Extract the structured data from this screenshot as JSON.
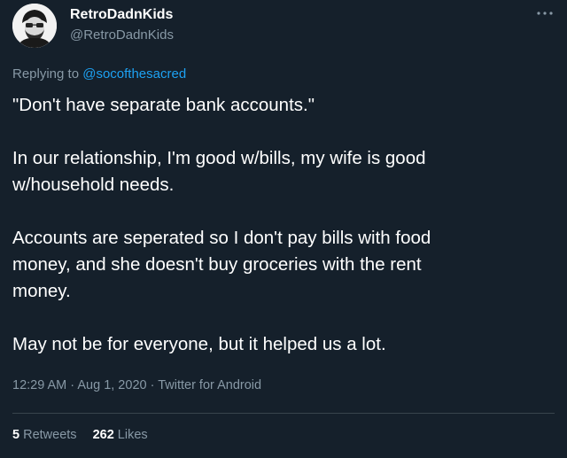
{
  "author": {
    "display_name": "RetroDadnKids",
    "handle": "@RetroDadnKids"
  },
  "reply": {
    "prefix": "Replying to",
    "mention": "@socofthesacred"
  },
  "body": {
    "paragraphs": [
      "\"Don't have separate bank accounts.\"",
      "In our relationship, I'm good w/bills, my wife is good\nw/household needs.",
      "Accounts are seperated so I don't pay bills with food\nmoney, and she doesn't buy groceries with the rent\nmoney.",
      "May not be for everyone, but it helped us a lot."
    ]
  },
  "meta": {
    "time": "12:29 AM",
    "date": "Aug 1, 2020",
    "source": "Twitter for Android",
    "separator": " · "
  },
  "stats": {
    "retweets_count": "5",
    "retweets_label": "Retweets",
    "likes_count": "262",
    "likes_label": "Likes"
  },
  "icons": {
    "more": "more-horizontal-icon",
    "avatar": "avatar-image"
  },
  "colors": {
    "background": "#15202b",
    "text_primary": "#ffffff",
    "text_secondary": "#8899a6",
    "link": "#1da1f2",
    "divider": "#38444d"
  }
}
